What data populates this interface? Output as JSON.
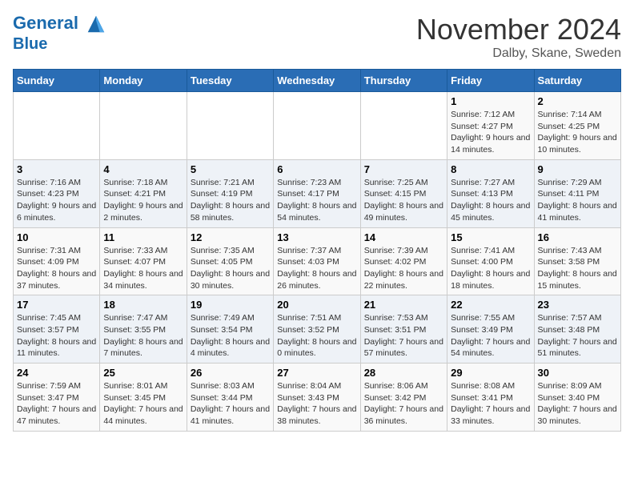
{
  "header": {
    "logo_line1": "General",
    "logo_line2": "Blue",
    "month": "November 2024",
    "location": "Dalby, Skane, Sweden"
  },
  "weekdays": [
    "Sunday",
    "Monday",
    "Tuesday",
    "Wednesday",
    "Thursday",
    "Friday",
    "Saturday"
  ],
  "weeks": [
    [
      {
        "day": "",
        "info": ""
      },
      {
        "day": "",
        "info": ""
      },
      {
        "day": "",
        "info": ""
      },
      {
        "day": "",
        "info": ""
      },
      {
        "day": "",
        "info": ""
      },
      {
        "day": "1",
        "info": "Sunrise: 7:12 AM\nSunset: 4:27 PM\nDaylight: 9 hours and 14 minutes."
      },
      {
        "day": "2",
        "info": "Sunrise: 7:14 AM\nSunset: 4:25 PM\nDaylight: 9 hours and 10 minutes."
      }
    ],
    [
      {
        "day": "3",
        "info": "Sunrise: 7:16 AM\nSunset: 4:23 PM\nDaylight: 9 hours and 6 minutes."
      },
      {
        "day": "4",
        "info": "Sunrise: 7:18 AM\nSunset: 4:21 PM\nDaylight: 9 hours and 2 minutes."
      },
      {
        "day": "5",
        "info": "Sunrise: 7:21 AM\nSunset: 4:19 PM\nDaylight: 8 hours and 58 minutes."
      },
      {
        "day": "6",
        "info": "Sunrise: 7:23 AM\nSunset: 4:17 PM\nDaylight: 8 hours and 54 minutes."
      },
      {
        "day": "7",
        "info": "Sunrise: 7:25 AM\nSunset: 4:15 PM\nDaylight: 8 hours and 49 minutes."
      },
      {
        "day": "8",
        "info": "Sunrise: 7:27 AM\nSunset: 4:13 PM\nDaylight: 8 hours and 45 minutes."
      },
      {
        "day": "9",
        "info": "Sunrise: 7:29 AM\nSunset: 4:11 PM\nDaylight: 8 hours and 41 minutes."
      }
    ],
    [
      {
        "day": "10",
        "info": "Sunrise: 7:31 AM\nSunset: 4:09 PM\nDaylight: 8 hours and 37 minutes."
      },
      {
        "day": "11",
        "info": "Sunrise: 7:33 AM\nSunset: 4:07 PM\nDaylight: 8 hours and 34 minutes."
      },
      {
        "day": "12",
        "info": "Sunrise: 7:35 AM\nSunset: 4:05 PM\nDaylight: 8 hours and 30 minutes."
      },
      {
        "day": "13",
        "info": "Sunrise: 7:37 AM\nSunset: 4:03 PM\nDaylight: 8 hours and 26 minutes."
      },
      {
        "day": "14",
        "info": "Sunrise: 7:39 AM\nSunset: 4:02 PM\nDaylight: 8 hours and 22 minutes."
      },
      {
        "day": "15",
        "info": "Sunrise: 7:41 AM\nSunset: 4:00 PM\nDaylight: 8 hours and 18 minutes."
      },
      {
        "day": "16",
        "info": "Sunrise: 7:43 AM\nSunset: 3:58 PM\nDaylight: 8 hours and 15 minutes."
      }
    ],
    [
      {
        "day": "17",
        "info": "Sunrise: 7:45 AM\nSunset: 3:57 PM\nDaylight: 8 hours and 11 minutes."
      },
      {
        "day": "18",
        "info": "Sunrise: 7:47 AM\nSunset: 3:55 PM\nDaylight: 8 hours and 7 minutes."
      },
      {
        "day": "19",
        "info": "Sunrise: 7:49 AM\nSunset: 3:54 PM\nDaylight: 8 hours and 4 minutes."
      },
      {
        "day": "20",
        "info": "Sunrise: 7:51 AM\nSunset: 3:52 PM\nDaylight: 8 hours and 0 minutes."
      },
      {
        "day": "21",
        "info": "Sunrise: 7:53 AM\nSunset: 3:51 PM\nDaylight: 7 hours and 57 minutes."
      },
      {
        "day": "22",
        "info": "Sunrise: 7:55 AM\nSunset: 3:49 PM\nDaylight: 7 hours and 54 minutes."
      },
      {
        "day": "23",
        "info": "Sunrise: 7:57 AM\nSunset: 3:48 PM\nDaylight: 7 hours and 51 minutes."
      }
    ],
    [
      {
        "day": "24",
        "info": "Sunrise: 7:59 AM\nSunset: 3:47 PM\nDaylight: 7 hours and 47 minutes."
      },
      {
        "day": "25",
        "info": "Sunrise: 8:01 AM\nSunset: 3:45 PM\nDaylight: 7 hours and 44 minutes."
      },
      {
        "day": "26",
        "info": "Sunrise: 8:03 AM\nSunset: 3:44 PM\nDaylight: 7 hours and 41 minutes."
      },
      {
        "day": "27",
        "info": "Sunrise: 8:04 AM\nSunset: 3:43 PM\nDaylight: 7 hours and 38 minutes."
      },
      {
        "day": "28",
        "info": "Sunrise: 8:06 AM\nSunset: 3:42 PM\nDaylight: 7 hours and 36 minutes."
      },
      {
        "day": "29",
        "info": "Sunrise: 8:08 AM\nSunset: 3:41 PM\nDaylight: 7 hours and 33 minutes."
      },
      {
        "day": "30",
        "info": "Sunrise: 8:09 AM\nSunset: 3:40 PM\nDaylight: 7 hours and 30 minutes."
      }
    ]
  ]
}
